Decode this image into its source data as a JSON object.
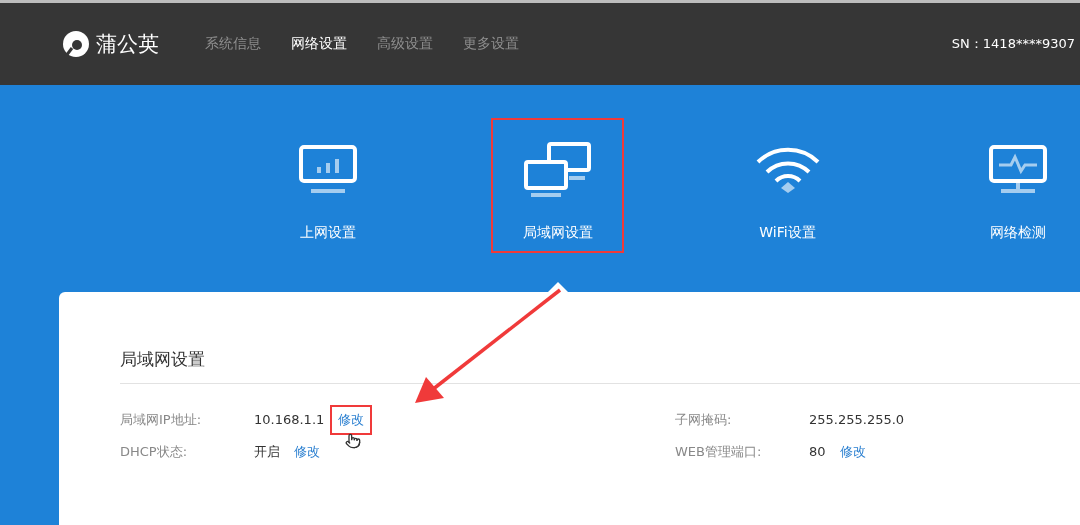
{
  "header": {
    "logo_text": "蒲公英",
    "nav": [
      {
        "label": "系统信息",
        "selected": false
      },
      {
        "label": "网络设置",
        "selected": true
      },
      {
        "label": "高级设置",
        "selected": false
      },
      {
        "label": "更多设置",
        "selected": false
      }
    ],
    "serial": "SN：1418****9307"
  },
  "tiles": [
    {
      "label": "上网设置",
      "selected": false,
      "highlighted": false
    },
    {
      "label": "局域网设置",
      "selected": true,
      "highlighted": true
    },
    {
      "label": "WiFi设置",
      "selected": false,
      "highlighted": false
    },
    {
      "label": "网络检测",
      "selected": false,
      "highlighted": false
    }
  ],
  "panel": {
    "title": "局域网设置",
    "fields": [
      {
        "label": "局域网IP地址:",
        "value": "10.168.1.1",
        "action": {
          "label": "修改",
          "highlighted": true
        }
      },
      {
        "label": "子网掩码:",
        "value": "255.255.255.0"
      },
      {
        "label": "DHCP状态:",
        "value": "开启",
        "action": {
          "label": "修改",
          "highlighted": false
        }
      },
      {
        "label": "WEB管理端口:",
        "value": "80",
        "action": {
          "label": "修改",
          "highlighted": false
        }
      }
    ]
  }
}
